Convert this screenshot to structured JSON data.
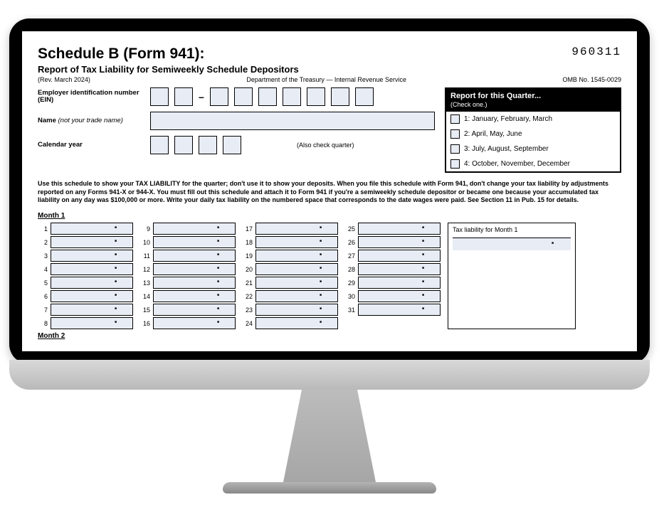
{
  "header": {
    "title": "Schedule B (Form 941):",
    "form_number": "960311",
    "subtitle": "Report of Tax Liability for Semiweekly Schedule Depositors",
    "revision": "(Rev. March 2024)",
    "department": "Department of the Treasury — Internal Revenue Service",
    "omb": "OMB No. 1545-0029"
  },
  "fields": {
    "ein_label": "Employer identification number (EIN)",
    "name_label_prefix": "Name ",
    "name_label_note": "(not your trade name)",
    "year_label": "Calendar year",
    "also_check": "(Also check quarter)"
  },
  "quarter": {
    "title": "Report for this Quarter...",
    "sub": "(Check one.)",
    "options": [
      "1: January, February, March",
      "2: April, May, June",
      "3: July, August, September",
      "4: October, November, December"
    ]
  },
  "instructions": "Use this schedule to show your TAX LIABILITY for the quarter; don't use it to show your deposits. When you file this schedule with Form 941, don't change your tax liability by adjustments reported on any Forms 941-X or 944-X. You must fill out this schedule and attach it to Form 941 if you're a semiweekly schedule depositor or became one because your accumulated tax liability on any day was $100,000 or more. Write your daily tax liability on the numbered space that corresponds to the date wages were paid. See Section 11 in Pub. 15 for details.",
  "month": {
    "label": "Month 1",
    "next_label": "Month 2",
    "total_label": "Tax liability for Month 1",
    "days_col1": [
      "1",
      "2",
      "3",
      "4",
      "5",
      "6",
      "7",
      "8"
    ],
    "days_col2": [
      "9",
      "10",
      "11",
      "12",
      "13",
      "14",
      "15",
      "16"
    ],
    "days_col3": [
      "17",
      "18",
      "19",
      "20",
      "21",
      "22",
      "23",
      "24"
    ],
    "days_col4": [
      "25",
      "26",
      "27",
      "28",
      "29",
      "30",
      "31"
    ]
  }
}
